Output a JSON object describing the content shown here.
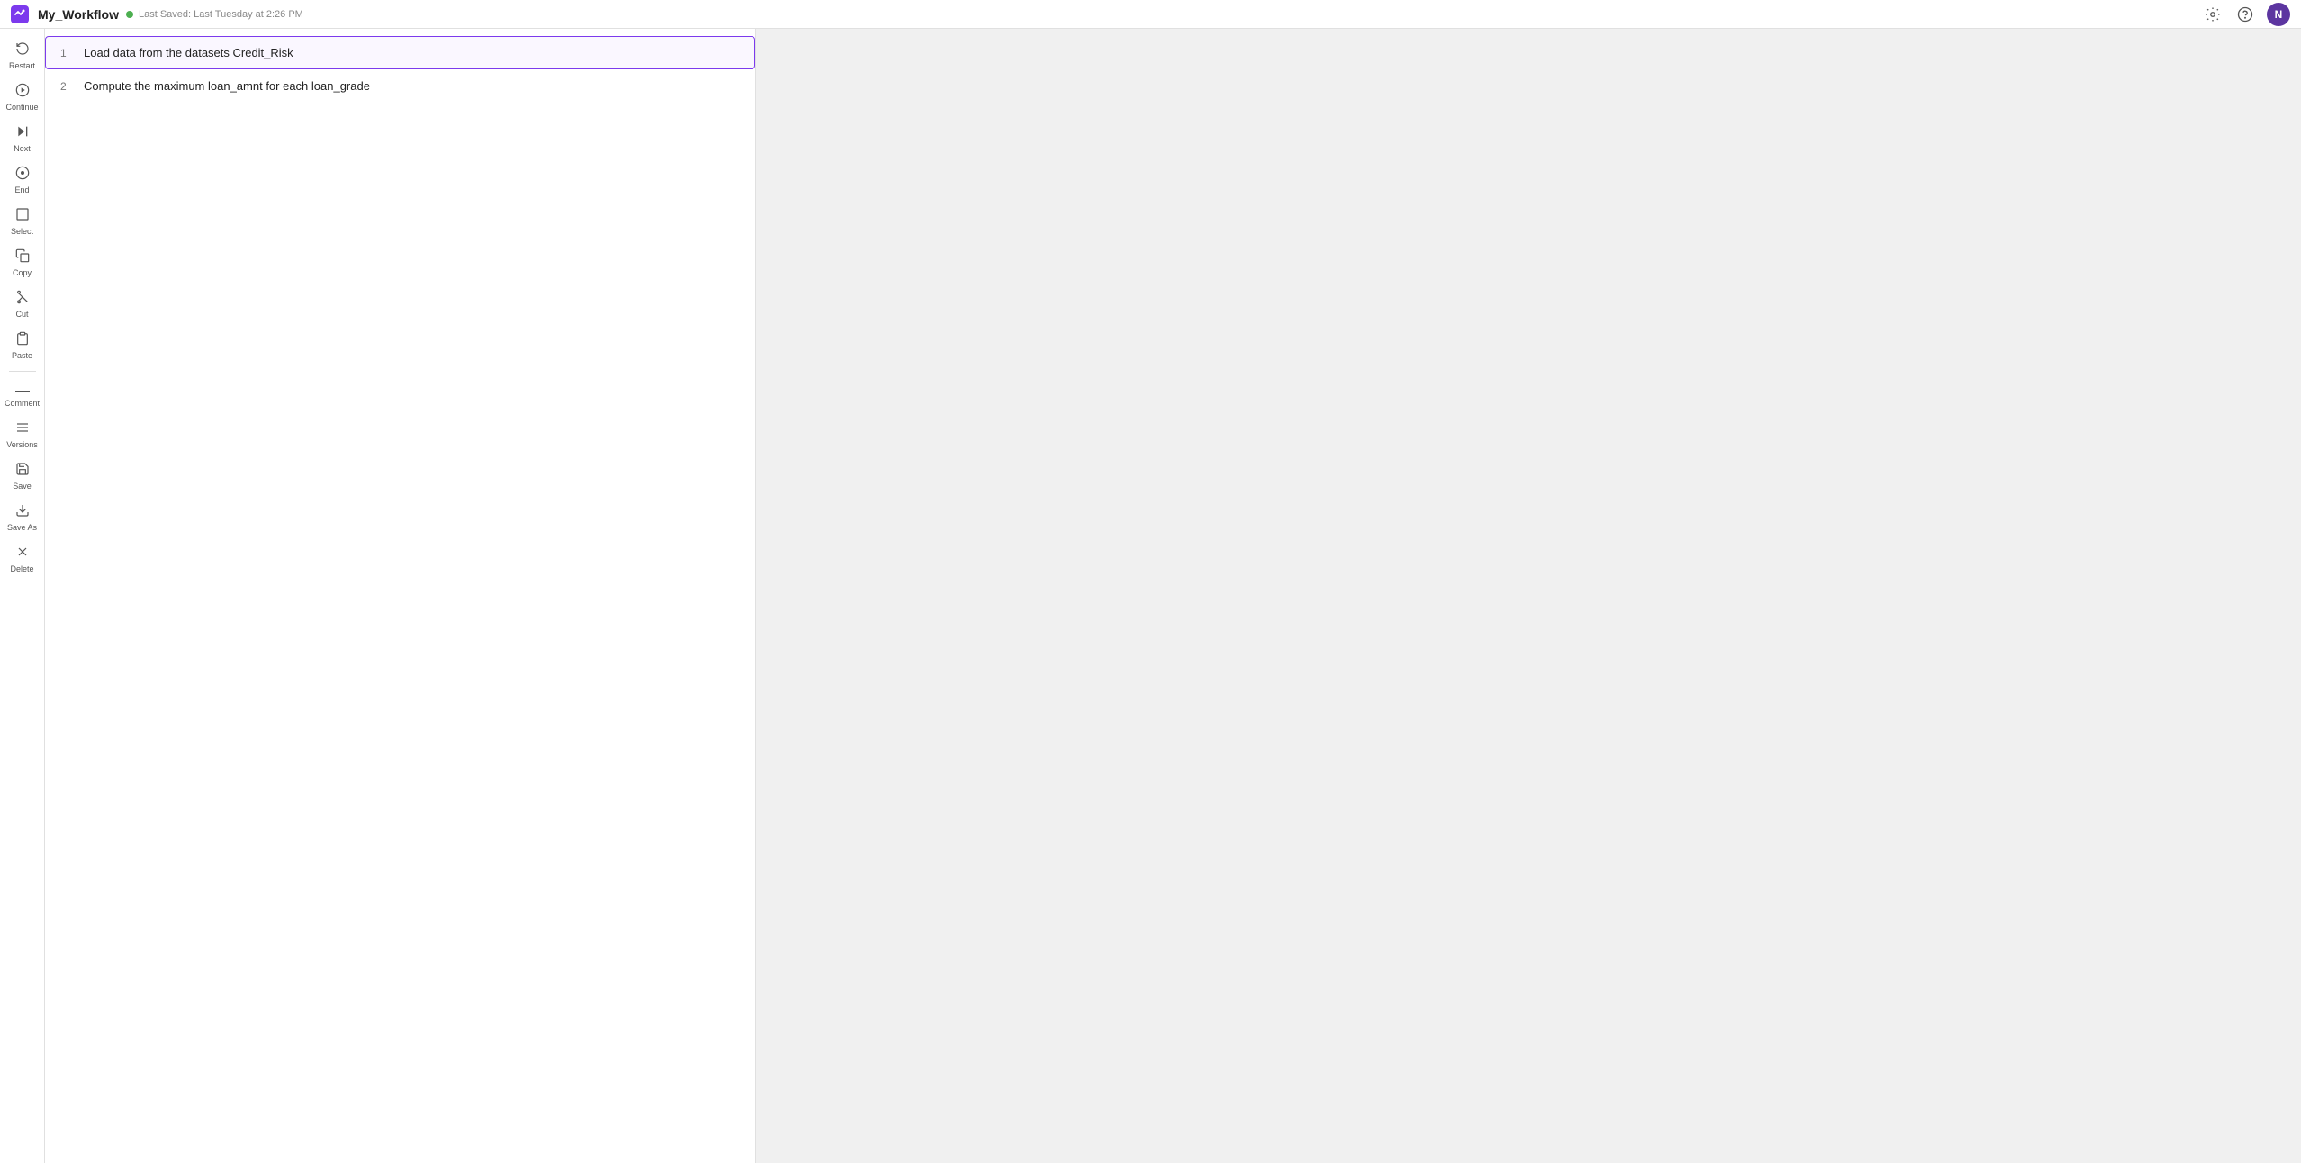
{
  "topbar": {
    "title": "My_Workflow",
    "saved_dot_color": "#4caf50",
    "saved_text": "Last Saved: Last Tuesday at 2:26 PM",
    "settings_icon": "⚙",
    "help_icon": "?",
    "avatar_initials": "N"
  },
  "sidebar": {
    "items": [
      {
        "id": "restart",
        "icon": "↺",
        "label": "Restart"
      },
      {
        "id": "continue",
        "icon": "▶",
        "label": "Continue"
      },
      {
        "id": "next",
        "icon": "▷|",
        "label": "Next"
      },
      {
        "id": "end",
        "icon": "⊙",
        "label": "End"
      },
      {
        "id": "select",
        "icon": "□",
        "label": "Select"
      },
      {
        "id": "copy",
        "icon": "⧉",
        "label": "Copy"
      },
      {
        "id": "cut",
        "icon": "✂",
        "label": "Cut"
      },
      {
        "id": "paste",
        "icon": "📋",
        "label": "Paste"
      },
      {
        "id": "comment",
        "icon": "—",
        "label": "Comment"
      },
      {
        "id": "versions",
        "icon": "≡",
        "label": "Versions"
      },
      {
        "id": "save",
        "icon": "💾",
        "label": "Save"
      },
      {
        "id": "save-as",
        "icon": "⬇",
        "label": "Save As"
      },
      {
        "id": "delete",
        "icon": "✕",
        "label": "Delete"
      }
    ]
  },
  "steps": [
    {
      "id": 1,
      "number": "1",
      "text": "Load data from the datasets Credit_Risk",
      "active": true
    },
    {
      "id": 2,
      "number": "2",
      "text": "Compute the maximum loan_amnt for each loan_grade",
      "active": false
    }
  ]
}
